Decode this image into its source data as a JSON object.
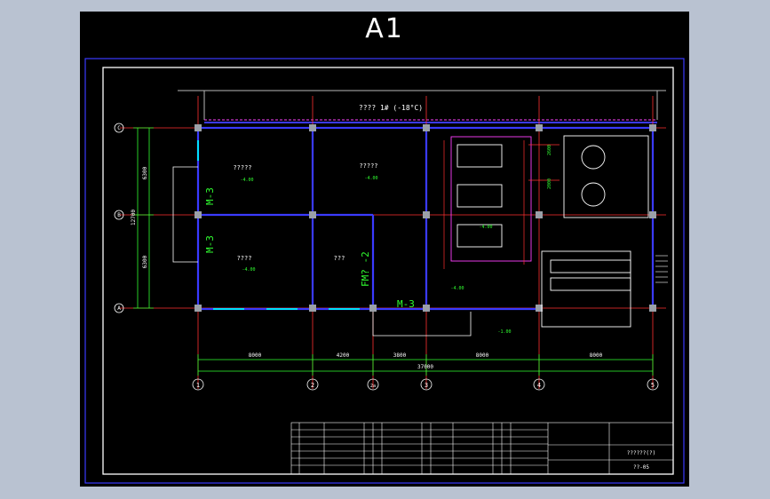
{
  "sheet_label": "A1",
  "top_label": "???? 1# (-18°C)",
  "rooms": {
    "r1": "?????",
    "r2": "?????",
    "r3": "????",
    "r4": "???"
  },
  "door_labels": {
    "m3_top": "M-3",
    "m3_mid": "M-3",
    "m3_bottom": "M-3",
    "fm": "FM? -2"
  },
  "elevations": {
    "e1": "-4.00",
    "e2": "-4.00",
    "e3": "-4.00",
    "e4": "-4.00",
    "e5": "-4.00",
    "e6": "-1.00"
  },
  "grid_rows": [
    "C",
    "B",
    "A"
  ],
  "grid_cols": [
    "1",
    "2",
    "2a",
    "3",
    "4",
    "5"
  ],
  "vertical_dims": {
    "d1": "6300",
    "d2": "6300",
    "total": "12700"
  },
  "horizontal_dims": {
    "d1": "8000",
    "d2": "4200",
    "d3": "3800",
    "d4": "8000",
    "d5": "8000",
    "total": "37000"
  },
  "equipment_dims": {
    "a": "2600",
    "b": "2000"
  },
  "title_block": {
    "drawing_title": "??????(?)",
    "drawing_no": "??-05"
  },
  "colors": {
    "wall": "#3a3aff",
    "grid": "#ff3030",
    "dimension": "#30ff30",
    "text": "#ffffff",
    "equipment": "#ff40ff",
    "frame": "#3a3aff"
  }
}
